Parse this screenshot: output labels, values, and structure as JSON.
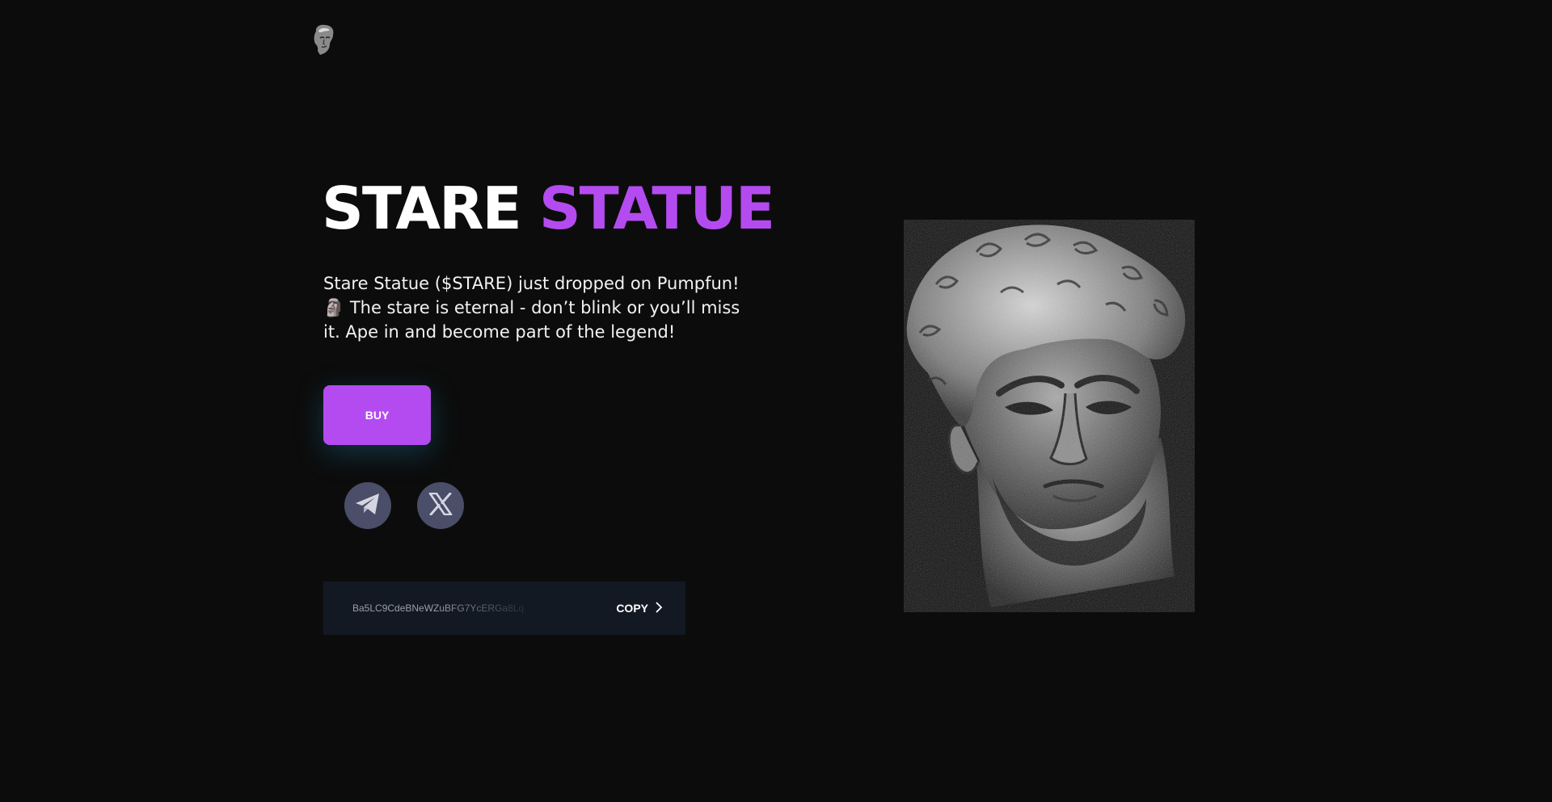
{
  "hero": {
    "title_word1": "STARE",
    "title_word2": "STATUE",
    "description": "Stare Statue ($STARE) just dropped on Pumpfun! 🗿 The stare is eternal - don’t blink or you’ll miss it. Ape in and become part of the legend!",
    "buy_label": "BUY"
  },
  "contract": {
    "address": "Ba5LC9CdeBNeWZuBFG7YcERGa8Lq",
    "copy_label": "COPY"
  },
  "icons": {
    "logo": "statue-head-logo",
    "social": [
      "telegram-icon",
      "x-icon"
    ],
    "copy": "chevron-right-icon",
    "hero_image": "statue-head-image"
  },
  "colors": {
    "background": "#0c0c0c",
    "accent": "#b44bf0",
    "social_bg": "#4a4e68",
    "address_box": "#131923"
  }
}
